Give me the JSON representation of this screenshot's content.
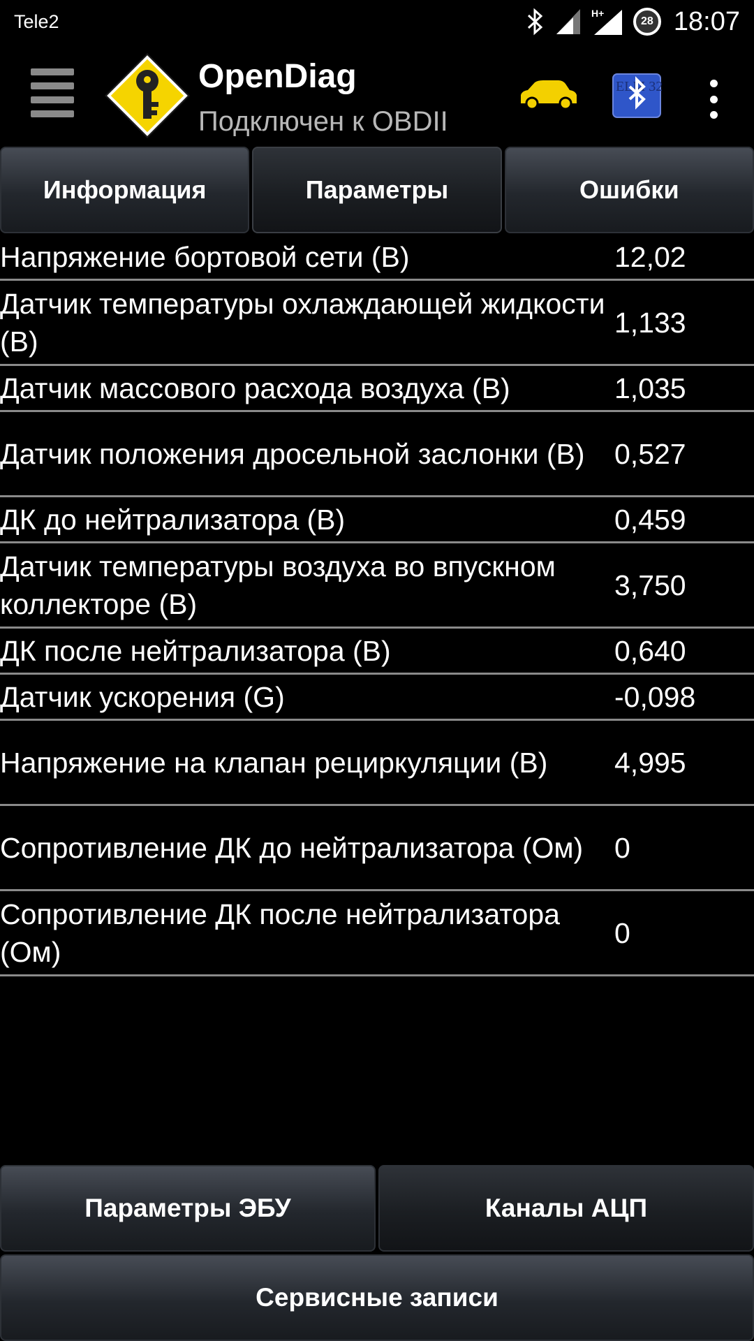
{
  "status_bar": {
    "carrier": "Tele2",
    "network_type": "H+",
    "battery_level": "28",
    "time": "18:07"
  },
  "action_bar": {
    "title": "OpenDiag",
    "subtitle": "Подключен к OBDII",
    "elm_icon_text": "ELM 327"
  },
  "tabs": [
    {
      "label": "Информация",
      "active": false
    },
    {
      "label": "Параметры",
      "active": true
    },
    {
      "label": "Ошибки",
      "active": false
    }
  ],
  "parameters": [
    {
      "label": "Напряжение бортовой сети (В)",
      "value": "12,02"
    },
    {
      "label": "Датчик температуры охлаждающей жидкости (В)",
      "value": "1,133"
    },
    {
      "label": "Датчик массового расхода воздуха (В)",
      "value": "1,035"
    },
    {
      "label": "Датчик положения дросельной заслонки (В)",
      "value": "0,527"
    },
    {
      "label": "ДК до нейтрализатора (В)",
      "value": "0,459"
    },
    {
      "label": "Датчик температуры воздуха во впускном коллекторе (В)",
      "value": "3,750"
    },
    {
      "label": "ДК после нейтрализатора (В)",
      "value": "0,640"
    },
    {
      "label": "Датчик ускорения (G)",
      "value": "-0,098"
    },
    {
      "label": "Напряжение на клапан рециркуляции (В)",
      "value": "4,995"
    },
    {
      "label": "Сопротивление ДК до нейтрализатора (Ом)",
      "value": "0"
    },
    {
      "label": "Сопротивление ДК после нейтрализатора (Ом)",
      "value": "0"
    }
  ],
  "bottom_buttons": {
    "ecu_params": "Параметры ЭБУ",
    "adc_channels": "Каналы АЦП",
    "service_records": "Сервисные записи"
  },
  "colors": {
    "background": "#000000",
    "logo_yellow": "#f5d400",
    "car_yellow": "#f3d000",
    "elm_blue": "#2f56c9",
    "divider": "#8a8a8a"
  }
}
